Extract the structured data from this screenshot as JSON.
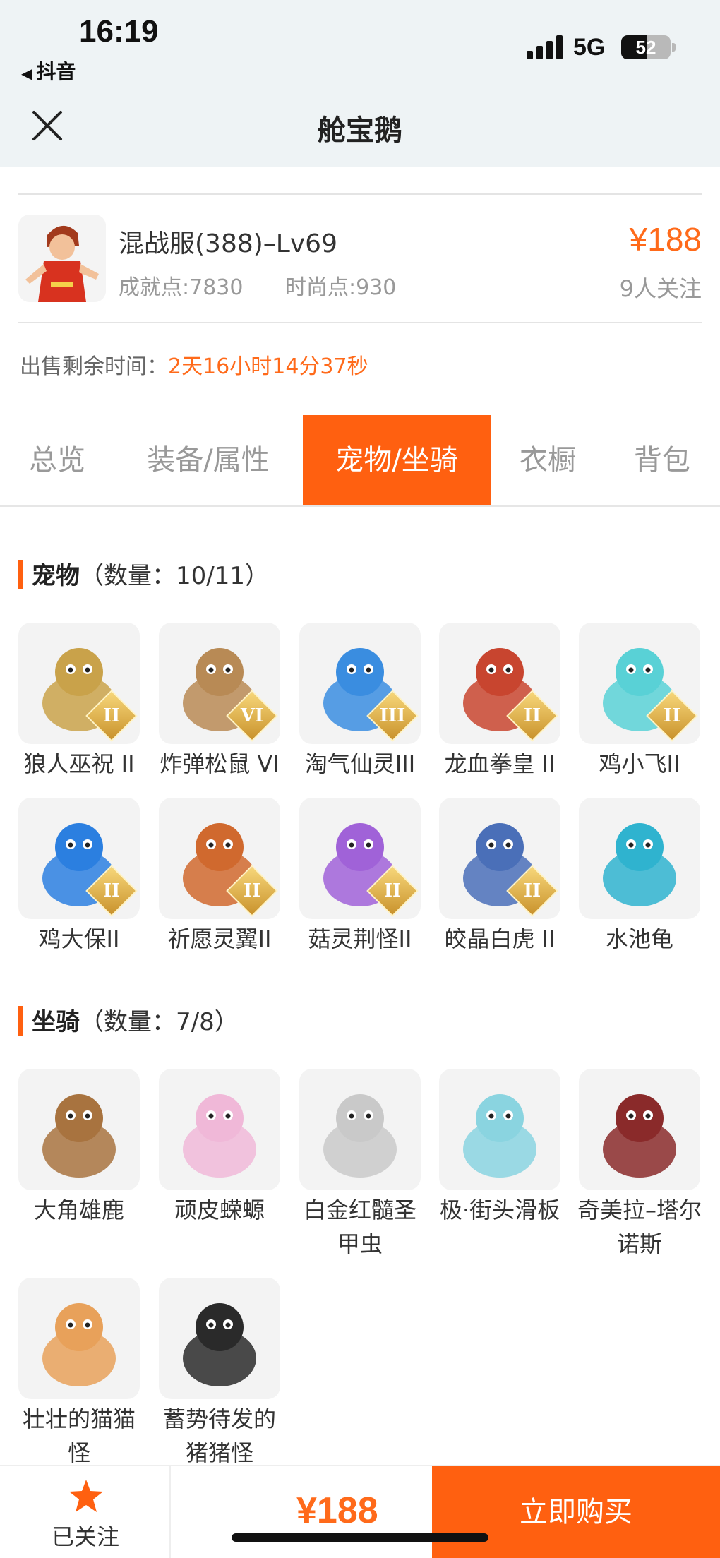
{
  "status_bar": {
    "time": "16:19",
    "back_app": "抖音",
    "network": "5G",
    "battery": "52",
    "battery_level": 0.52
  },
  "nav": {
    "title": "舱宝鹅"
  },
  "product": {
    "name": "混战服(388)–Lv69",
    "achievement": "成就点:7830",
    "fashion": "时尚点:930",
    "price": "¥188",
    "watchers": "9人关注"
  },
  "remaining": {
    "label": "出售剩余时间：",
    "value": "2天16小时14分37秒"
  },
  "tabs": [
    "总览",
    "装备/属性",
    "宠物/坐骑",
    "衣橱",
    "背包"
  ],
  "active_tab": "宠物/坐骑",
  "pets": {
    "title": "宠物",
    "count": "（数量：10/11）",
    "items": [
      {
        "name": "狼人巫祝 II",
        "badge": "II",
        "icon": "wolf-shaman-icon",
        "color": "#c9a24a"
      },
      {
        "name": "炸弹松鼠 VI",
        "badge": "VI",
        "icon": "bomb-squirrel-icon",
        "color": "#b88a55"
      },
      {
        "name": "淘气仙灵III",
        "badge": "III",
        "icon": "naughty-spirit-icon",
        "color": "#3a8de0"
      },
      {
        "name": "龙血拳皇 II",
        "badge": "II",
        "icon": "dragon-boxer-icon",
        "color": "#c8452f"
      },
      {
        "name": "鸡小飞II",
        "badge": "II",
        "icon": "chick-fly-icon",
        "color": "#59d1d6"
      },
      {
        "name": "鸡大保II",
        "badge": "II",
        "icon": "chick-guard-icon",
        "color": "#2b7fe0"
      },
      {
        "name": "祈愿灵翼II",
        "badge": "II",
        "icon": "wish-wing-icon",
        "color": "#d0692e"
      },
      {
        "name": "菇灵荆怪II",
        "badge": "II",
        "icon": "mushroom-spirit-icon",
        "color": "#a062d8"
      },
      {
        "name": "皎晶白虎 II",
        "badge": "II",
        "icon": "white-tiger-icon",
        "color": "#4a6fb8"
      },
      {
        "name": "水池龟",
        "badge": "",
        "icon": "pond-turtle-icon",
        "color": "#2fb3cf"
      }
    ]
  },
  "mounts": {
    "title": "坐骑",
    "count": "（数量：7/8）",
    "items": [
      {
        "name": "大角雄鹿",
        "icon": "great-elk-icon",
        "color": "#a8733f"
      },
      {
        "name": "顽皮蝾螈",
        "icon": "naughty-salamander-icon",
        "color": "#f0b8d8"
      },
      {
        "name": "白金红髓圣甲虫",
        "icon": "platinum-beetle-icon",
        "color": "#c9c9c9"
      },
      {
        "name": "极·街头滑板",
        "icon": "street-skateboard-icon",
        "color": "#8ad4e0"
      },
      {
        "name": "奇美拉–塔尔诺斯",
        "icon": "chimera-icon",
        "color": "#8a2a2a"
      },
      {
        "name": "壮壮的猫猫怪",
        "icon": "chubby-cat-icon",
        "color": "#e8a15a"
      },
      {
        "name": "蓄势待发的猪猪怪",
        "icon": "ready-pig-icon",
        "color": "#2a2a2a"
      }
    ]
  },
  "bottom": {
    "follow_label": "已关注",
    "price": "¥188",
    "buy_label": "立即购买"
  },
  "colors": {
    "accent": "#ff6010",
    "price": "#ff6a1a",
    "header_bg": "#eef3f5"
  }
}
